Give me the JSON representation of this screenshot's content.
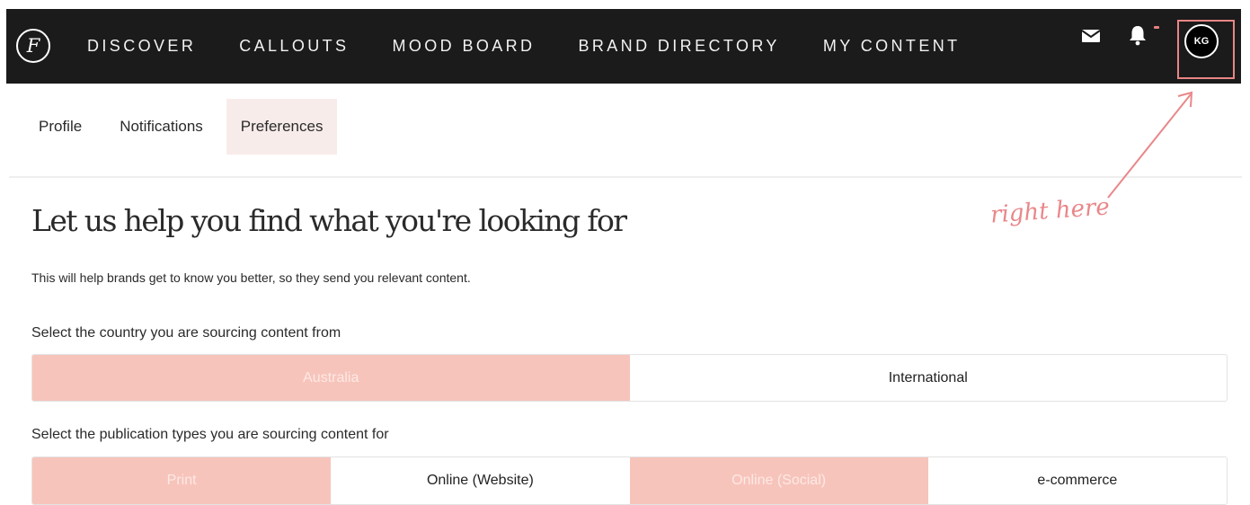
{
  "header": {
    "logo_letter": "F",
    "nav": [
      "DISCOVER",
      "CALLOUTS",
      "MOOD BOARD",
      "BRAND DIRECTORY",
      "MY CONTENT"
    ],
    "avatar_initials": "KG"
  },
  "tabs": [
    "Profile",
    "Notifications",
    "Preferences"
  ],
  "active_tab": "Preferences",
  "main": {
    "heading": "Let us help you find what you're looking for",
    "subtitle": "This will help brands get to know you better, so they send you relevant content.",
    "country_label": "Select the country you are sourcing content from",
    "country_options": [
      "Australia",
      "International"
    ],
    "publication_label": "Select the publication types you are sourcing content for",
    "publication_options": [
      "Print",
      "Online (Website)",
      "Online (Social)",
      "e-commerce"
    ]
  },
  "annotation": {
    "text": "right here"
  },
  "colors": {
    "topbar": "#1b1b1b",
    "selected": "#f7c4bb",
    "active_tab": "#f8ecea",
    "annotation": "#e9878a"
  }
}
